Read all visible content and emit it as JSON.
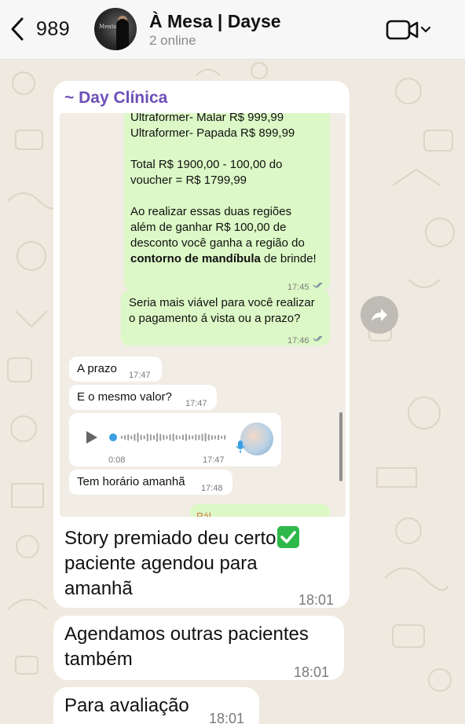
{
  "header": {
    "back_count": "989",
    "title": "À Mesa | Dayse",
    "subtitle": "2 online",
    "avatar_text": "Mentoria"
  },
  "quote": {
    "author": "~ Day Clínica",
    "msg1": {
      "lines": [
        "Ultraformer- Malar R$ 999,99",
        "Ultraformer- Papada R$ 899,99",
        "",
        "Total R$ 1900,00 - 100,00 do",
        "voucher = R$ 1799,99",
        "",
        "Ao realizar essas duas regiões",
        "além de ganhar R$ 100,00 de",
        "desconto você ganha a região do"
      ],
      "bold_part": "contorno de mandíbula",
      "tail_part": " de brinde!",
      "time": "17:45"
    },
    "msg2": {
      "line1": "Seria mais viável para você realizar",
      "line2": "o pagamento á vista ou a prazo?",
      "time": "17:46"
    },
    "msg3": {
      "text": "A prazo",
      "time": "17:47"
    },
    "msg4": {
      "text": "E o mesmo valor?",
      "time": "17:47"
    },
    "audio": {
      "elapsed": "0:08",
      "time": "17:47"
    },
    "msg5": {
      "text": "Tem horário amanhã",
      "time": "17:48"
    },
    "partial_text": "Pál"
  },
  "messages": [
    {
      "line1": "Story premiado deu certo",
      "line2": "paciente agendou para",
      "line3": "amanhã",
      "time": "18:01"
    },
    {
      "line1": "Agendamos outras pacientes",
      "line2": "também",
      "time": "18:01"
    },
    {
      "line1": "Para avaliação",
      "time": "18:01"
    }
  ],
  "colors": {
    "outgoing": "#dcf8c6",
    "incoming": "#ffffff",
    "author": "#6c4fb6",
    "check_emoji": "#2fb84a",
    "read_ticks": "#7a8ea0"
  },
  "icons": [
    "back-chevron-icon",
    "video-camera-icon",
    "chevron-down-icon",
    "play-icon",
    "microphone-icon",
    "forward-icon",
    "check-emoji-icon"
  ]
}
